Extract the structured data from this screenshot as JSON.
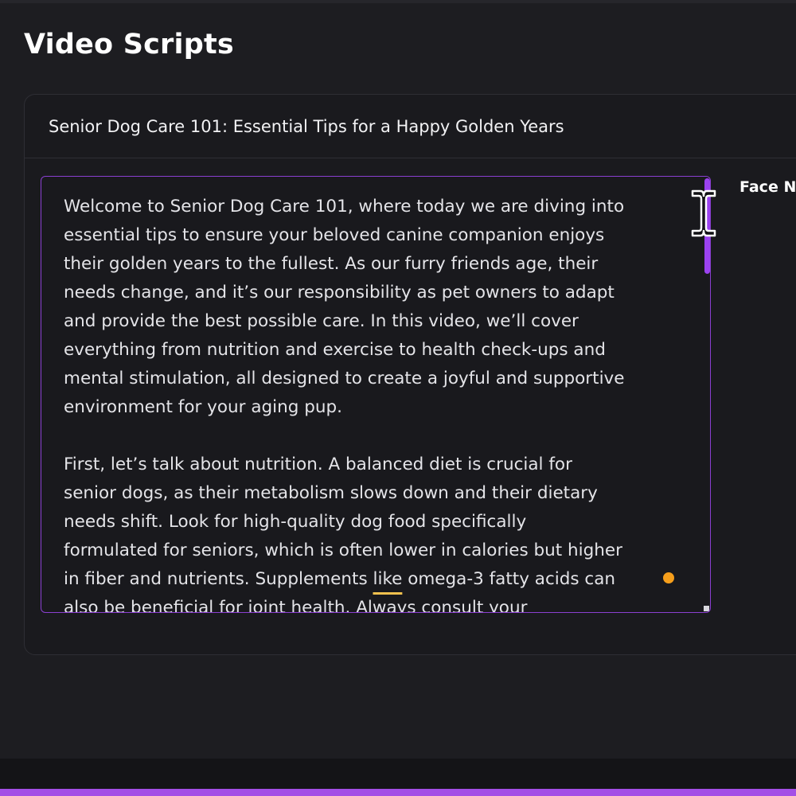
{
  "page": {
    "title": "Video Scripts"
  },
  "card": {
    "title": "Senior Dog Care 101: Essential Tips for a Happy Golden Years"
  },
  "editor": {
    "paragraph1": "Welcome to Senior Dog Care 101, where today we are diving into\nessential tips to ensure your beloved canine companion enjoys\ntheir golden years to the fullest. As our furry friends age, their\nneeds change, and it’s our responsibility as pet owners to adapt\nand provide the best possible care. In this video, we’ll cover\neverything from nutrition and exercise to health check-ups and\nmental stimulation, all designed to create a joyful and supportive\nenvironment for your aging pup.",
    "paragraph2_before": "First, let’s talk about nutrition. A balanced diet is crucial for\nsenior dogs, as their metabolism slows down and their dietary\nneeds shift. Look for high-quality dog food specifically\nformulated for seniors, which is often lower in calories but higher\nin fiber and nutrients. Supplements ",
    "paragraph2_flagged_word": "like",
    "paragraph2_after": " omega-3 fatty acids can\nalso be beneficial for joint health. Always consult your"
  },
  "side_panel": {
    "label": "Face N"
  },
  "icons": {
    "cursor": "text-cursor-icon",
    "spellcheck": "spellcheck-dot-icon"
  },
  "colors": {
    "accent": "#a44ee6",
    "editor_border": "#8a3fd1",
    "spellcheck_underline": "#f2c14e",
    "spellcheck_dot": "#f59e1b"
  }
}
